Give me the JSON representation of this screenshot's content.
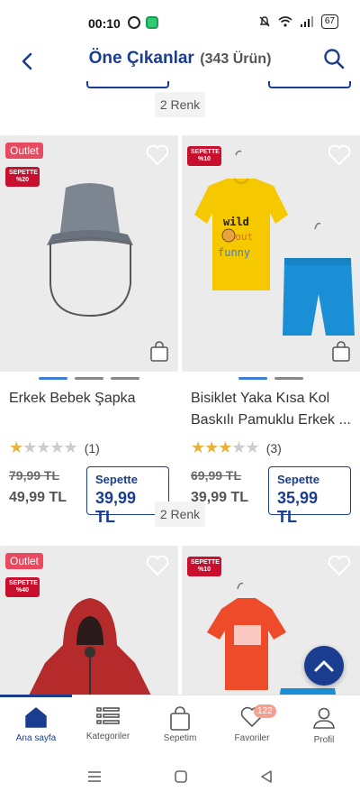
{
  "status": {
    "time": "00:10",
    "battery": "67"
  },
  "header": {
    "title": "Öne Çıkanlar",
    "count": "(343 Ürün)"
  },
  "renk_top": "2 Renk",
  "renk_mid": "2 Renk",
  "products": [
    {
      "name": "Erkek Bebek Şapka",
      "outlet": "Outlet",
      "sepette_badge_line1": "SEPETTE",
      "sepette_badge_line2": "%20",
      "rating_count": "(1)",
      "stars_filled": 1,
      "old_price": "79,99 TL",
      "price": "49,99 TL",
      "sepette_label": "Sepette",
      "sepette_price": "39,99 TL"
    },
    {
      "name": "Bisiklet Yaka Kısa Kol Baskılı Pamuklu Erkek ...",
      "sepette_badge_line1": "SEPETTE",
      "sepette_badge_line2": "%10",
      "rating_count": "(3)",
      "stars_filled": 3,
      "old_price": "69,99 TL",
      "price": "39,99 TL",
      "sepette_label": "Sepette",
      "sepette_price": "35,99 TL",
      "tshirt_text": [
        "wild",
        "about",
        "funny"
      ]
    },
    {
      "outlet": "Outlet",
      "sepette_badge_line1": "SEPETTE",
      "sepette_badge_line2": "%40"
    },
    {
      "sepette_badge_line1": "SEPETTE",
      "sepette_badge_line2": "%10"
    }
  ],
  "bottom_nav": [
    {
      "label": "Ana sayfa",
      "icon": "home-icon"
    },
    {
      "label": "Kategoriler",
      "icon": "list-icon"
    },
    {
      "label": "Sepetim",
      "icon": "bag-icon"
    },
    {
      "label": "Favoriler",
      "icon": "heart-icon",
      "badge": "122"
    },
    {
      "label": "Profil",
      "icon": "profile-icon"
    }
  ],
  "colors": {
    "primary": "#1a3d8f",
    "badge_red": "#c8102e",
    "outlet": "#e84a5f",
    "star": "#e8b33c",
    "active_dot": "#3d7fd1"
  }
}
